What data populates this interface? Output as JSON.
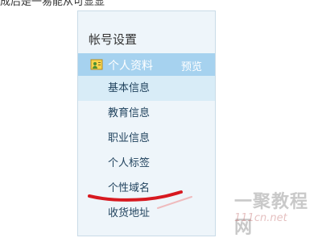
{
  "page": {
    "top_text": "成后是一易能从可显显"
  },
  "sidebar": {
    "title": "帐号设置",
    "profile": {
      "icon": "user-card-icon",
      "label": "个人资料",
      "action_label": "预览"
    },
    "items": [
      {
        "label": "基本信息",
        "active": true
      },
      {
        "label": "教育信息",
        "active": false
      },
      {
        "label": "职业信息",
        "active": false
      },
      {
        "label": "个人标签",
        "active": false
      },
      {
        "label": "个性域名",
        "active": false
      },
      {
        "label": "收货地址",
        "active": false
      }
    ]
  },
  "watermark": {
    "title": "一聚教程网",
    "domain": "111cn.net"
  },
  "colors": {
    "panel_bg": "#eef5fa",
    "selected_row": "#a6d2ef",
    "active_item": "#d8ecf7",
    "text": "#22445f",
    "underline": "#d71920"
  }
}
